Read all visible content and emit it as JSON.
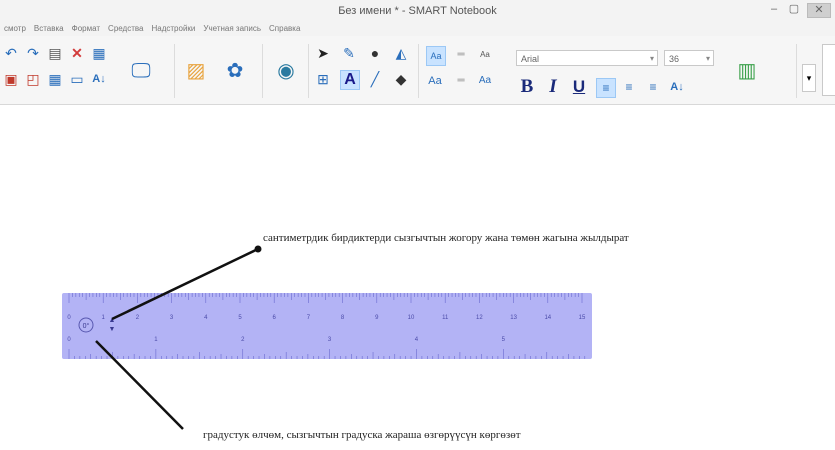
{
  "window": {
    "title": "Без имени * - SMART Notebook",
    "minimize_glyph": "–",
    "maximize_glyph": "▢",
    "close_glyph": "✕"
  },
  "menubar": [
    "смотр",
    "Вставка",
    "Формат",
    "Средства",
    "Надстройки",
    "Учетная запись",
    "Справка"
  ],
  "toolbar": {
    "font_name": "Arial",
    "font_size": "36",
    "bold_label": "B",
    "italic_label": "I",
    "underline_label": "U",
    "text_tool_label": "A",
    "aa_large": "Aa",
    "aa_small": "Aa",
    "aa_medium": "Aa"
  },
  "canvas": {
    "annotation_top": "сантиметрдик бирдиктерди сызгычтын жогору жана төмөн жагына жылдырат",
    "annotation_bottom": "градустук өлчөм, сызгычтын градуска жараша өзгөрүүсүн көргөзөт"
  },
  "ruler": {
    "top_labels": [
      "0",
      "1",
      "2",
      "3",
      "4",
      "5",
      "6",
      "7",
      "8",
      "9",
      "10",
      "11",
      "12",
      "13",
      "14",
      "15"
    ],
    "bottom_labels": [
      "0",
      "1",
      "2",
      "3",
      "4",
      "5"
    ],
    "rotation_readout": "0°",
    "color": "#b3b3f5"
  }
}
